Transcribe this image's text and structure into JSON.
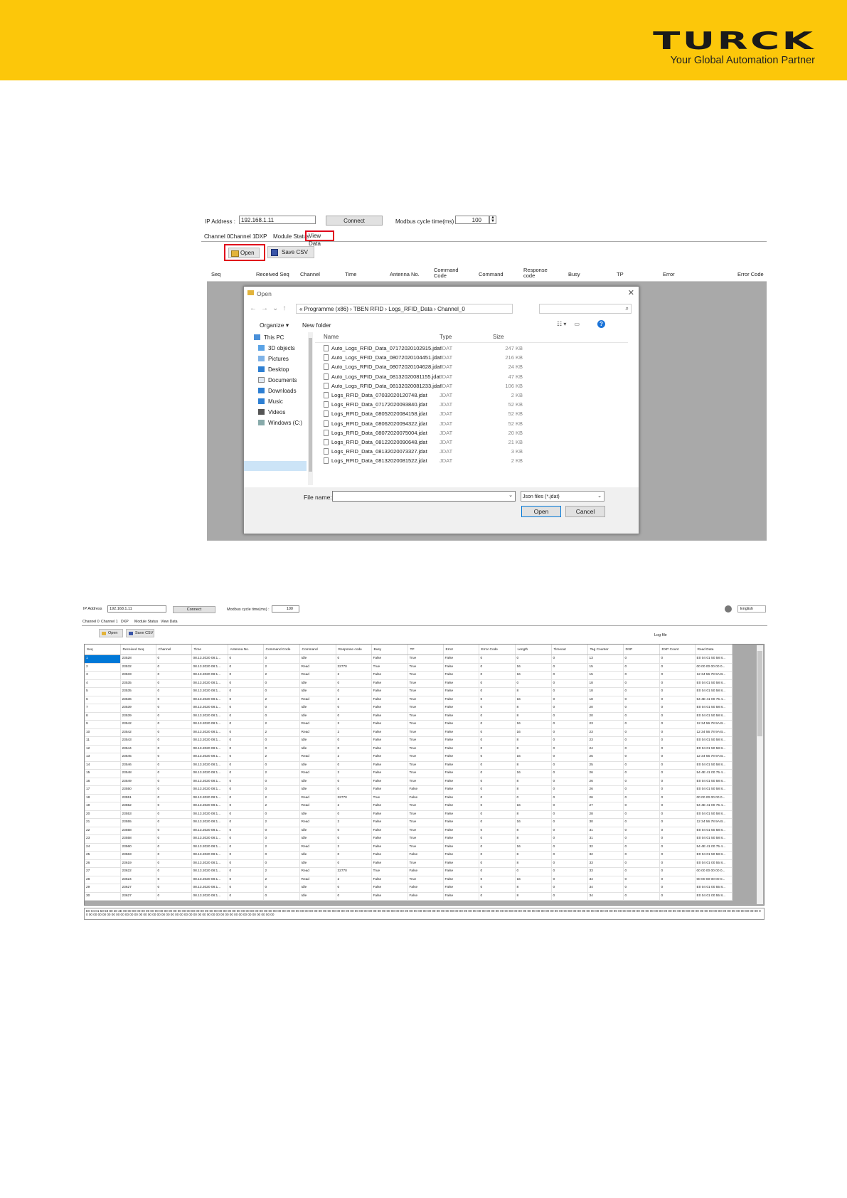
{
  "brand": {
    "logo_text": "TURCK",
    "tagline": "Your Global Automation Partner",
    "banner_color": "#fcc70a",
    "highlight_color": "#e0001b"
  },
  "shot1": {
    "ip_label": "IP Address :",
    "ip_value": "192.168.1.11",
    "connect_label": "Connect",
    "modbus_label": "Modbus cycle time(ms) :",
    "modbus_value": "100",
    "tabs": [
      "Channel 0",
      "Channel 1",
      "DXP",
      "Module Status",
      "View Data"
    ],
    "open_label": "Open",
    "save_csv_label": "Save CSV",
    "columns": [
      "Seq",
      "Received Seq",
      "Channel",
      "Time",
      "Antenna No.",
      "Command Code",
      "Command",
      "Response code",
      "Busy",
      "TP",
      "Error",
      "Error Code"
    ],
    "dialog": {
      "title": "Open",
      "path": "«  Programme (x86)  ›  TBEN RFID  ›  Logs_RFID_Data  ›  Channel_0",
      "organize": "Organize ▾",
      "new_folder": "New folder",
      "tree": [
        "This PC",
        "3D objects",
        "Pictures",
        "Desktop",
        "Documents",
        "Downloads",
        "Music",
        "Videos",
        "Windows (C:)"
      ],
      "list_headers": {
        "name": "Name",
        "type": "Type",
        "size": "Size"
      },
      "files": [
        {
          "name": "Auto_Logs_RFID_Data_07172020102915.jdat",
          "type": "JDAT",
          "size": "247 KB"
        },
        {
          "name": "Auto_Logs_RFID_Data_08072020104451.jdat",
          "type": "JDAT",
          "size": "216 KB"
        },
        {
          "name": "Auto_Logs_RFID_Data_08072020104628.jdat",
          "type": "JDAT",
          "size": "24 KB"
        },
        {
          "name": "Auto_Logs_RFID_Data_08132020081155.jdat",
          "type": "JDAT",
          "size": "47 KB"
        },
        {
          "name": "Auto_Logs_RFID_Data_08132020081233.jdat",
          "type": "JDAT",
          "size": "106 KB"
        },
        {
          "name": "Logs_RFID_Data_07032020120748.jdat",
          "type": "JDAT",
          "size": "2 KB"
        },
        {
          "name": "Logs_RFID_Data_07172020093840.jdat",
          "type": "JDAT",
          "size": "52 KB"
        },
        {
          "name": "Logs_RFID_Data_08052020084158.jdat",
          "type": "JDAT",
          "size": "52 KB"
        },
        {
          "name": "Logs_RFID_Data_08062020094322.jdat",
          "type": "JDAT",
          "size": "52 KB"
        },
        {
          "name": "Logs_RFID_Data_08072020075004.jdat",
          "type": "JDAT",
          "size": "20 KB"
        },
        {
          "name": "Logs_RFID_Data_08122020090648.jdat",
          "type": "JDAT",
          "size": "21 KB"
        },
        {
          "name": "Logs_RFID_Data_08132020073327.jdat",
          "type": "JDAT",
          "size": "3 KB"
        },
        {
          "name": "Logs_RFID_Data_08132020081522.jdat",
          "type": "JDAT",
          "size": "2 KB"
        }
      ],
      "file_name_label": "File name:",
      "file_type": "Json files (*.jdat)",
      "open_btn": "Open",
      "cancel_btn": "Cancel"
    }
  },
  "shot2": {
    "ip_label": "IP Address",
    "ip_value": "192.168.1.11",
    "connect_label": "Connect",
    "modbus_label": "Modbus cycle time(ms) :",
    "modbus_value": "100",
    "language": "English",
    "tabs": [
      "Channel 0",
      "Channel 1",
      "DXP",
      "Module Status",
      "View Data"
    ],
    "open_label": "Open",
    "save_csv_label": "Save CSV",
    "log_file_label": "Log file",
    "columns": [
      "Seq",
      "Received Seq",
      "Channel",
      "Time",
      "Antenna No.",
      "Command Code",
      "Command",
      "Response code",
      "Busy",
      "TP",
      "Error",
      "Error Code",
      "Length",
      "Timeout",
      "Tag Counter",
      "DXP",
      "DXP Count",
      "Read Data"
    ],
    "rows": [
      [
        "1",
        "23528",
        "0",
        "08.13.2020 08:1...",
        "0",
        "0",
        "Idle",
        "0",
        "False",
        "True",
        "False",
        "0",
        "0",
        "0",
        "13",
        "0",
        "0",
        "E0 04 01 50 58 8..."
      ],
      [
        "2",
        "23532",
        "0",
        "08.13.2020 08:1...",
        "0",
        "2",
        "Read",
        "32770",
        "True",
        "True",
        "False",
        "0",
        "16",
        "0",
        "15",
        "0",
        "0",
        "00 00 00 00 00 0..."
      ],
      [
        "3",
        "23533",
        "0",
        "08.13.2020 08:1...",
        "0",
        "2",
        "Read",
        "2",
        "False",
        "True",
        "False",
        "0",
        "16",
        "0",
        "15",
        "0",
        "0",
        "12 34 56 78 9A B..."
      ],
      [
        "4",
        "23535",
        "0",
        "08.13.2020 08:1...",
        "0",
        "0",
        "Idle",
        "0",
        "False",
        "True",
        "False",
        "0",
        "0",
        "0",
        "18",
        "0",
        "0",
        "E0 04 01 50 58 8..."
      ],
      [
        "5",
        "23535",
        "0",
        "08.13.2020 08:1...",
        "0",
        "0",
        "Idle",
        "0",
        "False",
        "True",
        "False",
        "0",
        "8",
        "0",
        "18",
        "0",
        "0",
        "E0 04 01 50 58 8..."
      ],
      [
        "6",
        "23536",
        "0",
        "08.13.2020 08:1...",
        "0",
        "2",
        "Read",
        "2",
        "False",
        "True",
        "False",
        "0",
        "16",
        "0",
        "18",
        "0",
        "0",
        "54 4E 41 00 75 4..."
      ],
      [
        "7",
        "23539",
        "0",
        "08.13.2020 08:1...",
        "0",
        "0",
        "Idle",
        "0",
        "False",
        "True",
        "False",
        "0",
        "8",
        "0",
        "20",
        "0",
        "0",
        "E0 04 01 50 58 8..."
      ],
      [
        "8",
        "23539",
        "0",
        "08.13.2020 08:1...",
        "0",
        "0",
        "Idle",
        "0",
        "False",
        "True",
        "False",
        "0",
        "8",
        "0",
        "20",
        "0",
        "0",
        "E0 04 01 50 58 8..."
      ],
      [
        "9",
        "23542",
        "0",
        "08.13.2020 08:1...",
        "0",
        "2",
        "Read",
        "2",
        "False",
        "True",
        "False",
        "0",
        "16",
        "0",
        "23",
        "0",
        "0",
        "12 34 56 78 9A B..."
      ],
      [
        "10",
        "23542",
        "0",
        "08.13.2020 08:1...",
        "0",
        "2",
        "Read",
        "2",
        "False",
        "True",
        "False",
        "0",
        "16",
        "0",
        "23",
        "0",
        "0",
        "12 34 56 78 9A B..."
      ],
      [
        "11",
        "23543",
        "0",
        "08.13.2020 08:1...",
        "0",
        "0",
        "Idle",
        "0",
        "False",
        "True",
        "False",
        "0",
        "8",
        "0",
        "23",
        "0",
        "0",
        "E0 04 01 50 58 8..."
      ],
      [
        "12",
        "23544",
        "0",
        "08.13.2020 08:1...",
        "0",
        "0",
        "Idle",
        "0",
        "False",
        "True",
        "False",
        "0",
        "8",
        "0",
        "24",
        "0",
        "0",
        "E0 04 01 50 58 8..."
      ],
      [
        "13",
        "23545",
        "0",
        "08.13.2020 08:1...",
        "0",
        "2",
        "Read",
        "2",
        "False",
        "True",
        "False",
        "0",
        "16",
        "0",
        "25",
        "0",
        "0",
        "12 34 56 78 9A B..."
      ],
      [
        "14",
        "23546",
        "0",
        "08.13.2020 08:1...",
        "0",
        "0",
        "Idle",
        "0",
        "False",
        "True",
        "False",
        "0",
        "8",
        "0",
        "25",
        "0",
        "0",
        "E0 04 01 50 58 8..."
      ],
      [
        "15",
        "23548",
        "0",
        "08.13.2020 08:1...",
        "0",
        "2",
        "Read",
        "2",
        "False",
        "True",
        "False",
        "0",
        "16",
        "0",
        "26",
        "0",
        "0",
        "54 4E 41 00 75 4..."
      ],
      [
        "16",
        "23549",
        "0",
        "08.13.2020 08:1...",
        "0",
        "0",
        "Idle",
        "0",
        "False",
        "True",
        "False",
        "0",
        "8",
        "0",
        "26",
        "0",
        "0",
        "E0 04 01 50 58 8..."
      ],
      [
        "17",
        "23550",
        "0",
        "08.13.2020 08:1...",
        "0",
        "0",
        "Idle",
        "0",
        "False",
        "False",
        "False",
        "0",
        "8",
        "0",
        "26",
        "0",
        "0",
        "E0 04 01 50 58 8..."
      ],
      [
        "18",
        "23551",
        "0",
        "08.13.2020 08:1...",
        "0",
        "2",
        "Read",
        "32770",
        "True",
        "False",
        "False",
        "0",
        "0",
        "0",
        "26",
        "0",
        "0",
        "00 00 00 00 00 0..."
      ],
      [
        "19",
        "23552",
        "0",
        "08.13.2020 08:1...",
        "0",
        "2",
        "Read",
        "2",
        "False",
        "True",
        "False",
        "0",
        "16",
        "0",
        "27",
        "0",
        "0",
        "54 4E 41 00 75 4..."
      ],
      [
        "20",
        "23553",
        "0",
        "08.13.2020 08:1...",
        "0",
        "0",
        "Idle",
        "0",
        "False",
        "True",
        "False",
        "0",
        "8",
        "0",
        "28",
        "0",
        "0",
        "E0 04 01 50 58 8..."
      ],
      [
        "21",
        "23555",
        "0",
        "08.13.2020 08:1...",
        "0",
        "2",
        "Read",
        "2",
        "False",
        "True",
        "False",
        "0",
        "16",
        "0",
        "30",
        "0",
        "0",
        "12 34 56 78 9A B..."
      ],
      [
        "22",
        "23558",
        "0",
        "08.13.2020 08:1...",
        "0",
        "0",
        "Idle",
        "0",
        "False",
        "True",
        "False",
        "0",
        "8",
        "0",
        "31",
        "0",
        "0",
        "E0 04 01 50 58 8..."
      ],
      [
        "23",
        "23558",
        "0",
        "08.13.2020 08:1...",
        "0",
        "0",
        "Idle",
        "0",
        "False",
        "True",
        "False",
        "0",
        "8",
        "0",
        "31",
        "0",
        "0",
        "E0 04 01 50 58 8..."
      ],
      [
        "24",
        "23560",
        "0",
        "08.13.2020 08:1...",
        "0",
        "2",
        "Read",
        "2",
        "False",
        "True",
        "False",
        "0",
        "16",
        "0",
        "32",
        "0",
        "0",
        "54 4E 41 00 75 4..."
      ],
      [
        "25",
        "23563",
        "0",
        "08.13.2020 08:1...",
        "0",
        "0",
        "Idle",
        "0",
        "False",
        "False",
        "False",
        "0",
        "8",
        "0",
        "32",
        "0",
        "0",
        "E0 04 01 50 58 8..."
      ],
      [
        "26",
        "23619",
        "0",
        "08.13.2020 08:1...",
        "0",
        "0",
        "Idle",
        "0",
        "False",
        "True",
        "False",
        "0",
        "8",
        "0",
        "33",
        "0",
        "0",
        "E0 04 01 00 55 8..."
      ],
      [
        "27",
        "23622",
        "0",
        "08.13.2020 08:1...",
        "0",
        "2",
        "Read",
        "32770",
        "True",
        "False",
        "False",
        "0",
        "0",
        "0",
        "33",
        "0",
        "0",
        "00 00 00 00 00 0..."
      ],
      [
        "28",
        "23624",
        "0",
        "08.13.2020 08:1...",
        "0",
        "2",
        "Read",
        "2",
        "False",
        "True",
        "False",
        "0",
        "16",
        "0",
        "34",
        "0",
        "0",
        "00 00 00 00 00 0..."
      ],
      [
        "29",
        "23627",
        "0",
        "08.13.2020 08:1...",
        "0",
        "0",
        "Idle",
        "0",
        "False",
        "False",
        "False",
        "0",
        "8",
        "0",
        "34",
        "0",
        "0",
        "E0 04 01 00 55 8..."
      ],
      [
        "30",
        "23627",
        "0",
        "08.13.2020 08:1...",
        "0",
        "0",
        "Idle",
        "0",
        "False",
        "False",
        "False",
        "0",
        "8",
        "0",
        "34",
        "0",
        "0",
        "E0 04 01 00 55 8..."
      ]
    ],
    "log_text": "E0 04 01 50 58 80 30 2E 00 00 00 00 00 00 00 00 00 00 00 00 00 00 00 00 00 00 00 00 00 00 00 00 00 00 00 00 00 00 00 00 00 00 00 00 00 00 00 00 00 00 00 00 00 00 00 00 00 00 00 00 00 00 00 00 00 00 00 00 00 00 00 00 00 00 00 00 00 00 00 00 00 00 00 00 00 00 00 00 00 00 00 00 00 00 00 00 00 00 00 00 00 00 00 00 00 00 00 00 00 00 00 00 00 00 00 00 00 00 00 00 00 00 00 00 00 00 00 00 00 00 00 00 00 00 00 00 00 00 00 00 00 00 00 00 00 00 00 00 00 00 00 00 00 00 00 00 00 00 00 00 00 00 00 00 00 00 00 00 00 00 00 00 00 00 00 00 00 00 00 00 00 00 00 00 00 00 00 00 00 00"
  }
}
